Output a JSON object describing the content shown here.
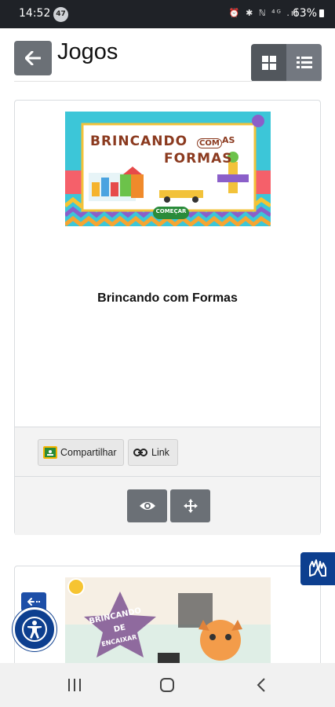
{
  "status_bar": {
    "time": "14:52",
    "notification_count": "47",
    "system_icons": "⏰ ✱ ℕ ⁴ᴳ .ıl",
    "battery": "63%"
  },
  "header": {
    "title": "Jogos",
    "back_icon": "arrow-left-icon",
    "view_grid_icon": "grid-icon",
    "view_list_icon": "list-icon"
  },
  "games": [
    {
      "title": "Brincando com Formas",
      "thumbnail": {
        "line1": "BRINCANDO",
        "com": "COM",
        "as": "AS",
        "line2": "FORMAS",
        "start_label": "COMEÇAR"
      },
      "share_label": "Compartilhar",
      "link_label": "Link"
    },
    {
      "thumbnail": {
        "line1": "BRINCANDO",
        "line2": "DE",
        "line3": "ENCAIXAR"
      }
    }
  ],
  "colors": {
    "status_bar": "#1f2227",
    "button_gray": "#6b7076",
    "accessibility_blue": "#0d3f8f",
    "card_border": "#d9dcdf",
    "footer_bg": "#f3f3f3"
  }
}
